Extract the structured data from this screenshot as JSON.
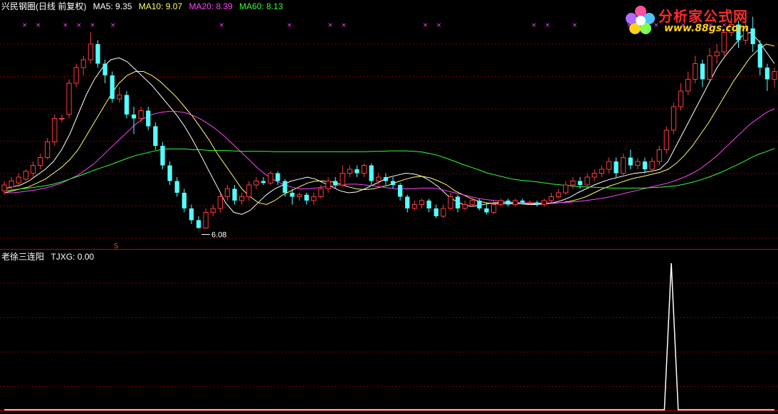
{
  "header_main": {
    "stock": "兴民钢圈(日线 前复权)",
    "ma5_label": "MA5: 9.35",
    "ma10_label": "MA10: 9.07",
    "ma20_label": "MA20: 8.39",
    "ma60_label": "MA60: 8.13"
  },
  "header_sub": {
    "indicator": "老徐三连阳",
    "value": "TJXG: 0.00"
  },
  "low_annotation": "6.08",
  "signal_marker": "S",
  "logo": {
    "text": "分析家公式网",
    "url": "www.88gs.com"
  },
  "colors": {
    "up": "#ff3c3c",
    "down": "#55ffff",
    "ma5": "#ffffff",
    "ma10": "#ffff66",
    "ma20": "#ff44ff",
    "ma60": "#33ff33",
    "grid": "#880000",
    "marker": "#ff44ff"
  },
  "chart_data": [
    {
      "type": "candlestick",
      "title": "兴民钢圈(日线 前复权)",
      "ylim": [
        5.6,
        11.6
      ],
      "grid": true,
      "series": [
        {
          "name": "MA5",
          "values": [
            7.1,
            7.15,
            7.2,
            7.3,
            7.45,
            7.6,
            7.8,
            8.1,
            8.5,
            9.0,
            9.5,
            9.9,
            10.2,
            10.4,
            10.45,
            10.35,
            10.15,
            9.95,
            9.75,
            9.5,
            9.25,
            9.0,
            8.7,
            8.35,
            7.95,
            7.55,
            7.15,
            6.75,
            6.5,
            6.45,
            6.55,
            6.75,
            6.95,
            7.1,
            7.2,
            7.3,
            7.35,
            7.4,
            7.35,
            7.25,
            7.15,
            7.05,
            7.0,
            7.02,
            7.1,
            7.2,
            7.3,
            7.4,
            7.45,
            7.5,
            7.48,
            7.42,
            7.3,
            7.15,
            6.95,
            6.8,
            6.7,
            6.65,
            6.68,
            6.72,
            6.75,
            6.75,
            6.74,
            6.72,
            6.7,
            6.7,
            6.72,
            6.75,
            6.8,
            6.88,
            7.0,
            7.1,
            7.2,
            7.28,
            7.35,
            7.4,
            7.45,
            7.5,
            7.52,
            7.55,
            7.6,
            7.8,
            8.2,
            8.6,
            9.0,
            9.4,
            9.8,
            10.2,
            10.5,
            10.75,
            11.0,
            11.1,
            10.9,
            10.6,
            10.3
          ]
        },
        {
          "name": "MA10",
          "values": [
            7.0,
            7.05,
            7.1,
            7.15,
            7.25,
            7.35,
            7.5,
            7.65,
            7.85,
            8.1,
            8.45,
            8.8,
            9.15,
            9.5,
            9.8,
            10.0,
            10.1,
            10.1,
            10.0,
            9.85,
            9.65,
            9.45,
            9.2,
            8.95,
            8.65,
            8.35,
            8.0,
            7.7,
            7.4,
            7.1,
            6.9,
            6.75,
            6.7,
            6.8,
            6.95,
            7.05,
            7.15,
            7.25,
            7.3,
            7.3,
            7.28,
            7.22,
            7.15,
            7.1,
            7.08,
            7.1,
            7.15,
            7.2,
            7.28,
            7.35,
            7.4,
            7.42,
            7.38,
            7.3,
            7.2,
            7.05,
            6.95,
            6.85,
            6.78,
            6.74,
            6.72,
            6.72,
            6.72,
            6.72,
            6.72,
            6.72,
            6.72,
            6.73,
            6.75,
            6.78,
            6.83,
            6.9,
            7.0,
            7.1,
            7.18,
            7.25,
            7.32,
            7.38,
            7.42,
            7.47,
            7.52,
            7.6,
            7.75,
            7.95,
            8.2,
            8.5,
            8.8,
            9.15,
            9.5,
            9.85,
            10.15,
            10.45,
            10.65,
            10.8,
            10.75
          ]
        },
        {
          "name": "MA20",
          "values": [
            7.0,
            7.0,
            7.02,
            7.05,
            7.08,
            7.12,
            7.18,
            7.25,
            7.35,
            7.45,
            7.6,
            7.75,
            7.95,
            8.15,
            8.35,
            8.55,
            8.75,
            8.9,
            9.0,
            9.05,
            9.08,
            9.08,
            9.05,
            8.98,
            8.88,
            8.75,
            8.6,
            8.42,
            8.22,
            8.02,
            7.82,
            7.62,
            7.45,
            7.32,
            7.22,
            7.15,
            7.1,
            7.1,
            7.12,
            7.15,
            7.18,
            7.2,
            7.22,
            7.22,
            7.2,
            7.18,
            7.15,
            7.12,
            7.1,
            7.1,
            7.1,
            7.12,
            7.12,
            7.1,
            7.05,
            7.0,
            6.95,
            6.9,
            6.85,
            6.82,
            6.8,
            6.78,
            6.76,
            6.75,
            6.74,
            6.74,
            6.74,
            6.74,
            6.75,
            6.76,
            6.78,
            6.8,
            6.83,
            6.86,
            6.9,
            6.95,
            7.0,
            7.05,
            7.1,
            7.15,
            7.2,
            7.25,
            7.32,
            7.4,
            7.5,
            7.62,
            7.78,
            7.95,
            8.15,
            8.35,
            8.55,
            8.75,
            8.9,
            9.05,
            9.15
          ]
        },
        {
          "name": "MA60",
          "values": [
            7.05,
            7.07,
            7.1,
            7.12,
            7.15,
            7.18,
            7.22,
            7.28,
            7.35,
            7.42,
            7.5,
            7.58,
            7.65,
            7.72,
            7.8,
            7.88,
            7.95,
            8.0,
            8.05,
            8.1,
            8.12,
            8.12,
            8.12,
            8.1,
            8.1,
            8.08,
            8.08,
            8.08,
            8.07,
            8.06,
            8.06,
            8.06,
            8.06,
            8.05,
            8.05,
            8.05,
            8.05,
            8.05,
            8.05,
            8.05,
            8.05,
            8.05,
            8.05,
            8.05,
            8.05,
            8.06,
            8.06,
            8.07,
            8.07,
            8.07,
            8.06,
            8.04,
            8.0,
            7.95,
            7.88,
            7.8,
            7.72,
            7.65,
            7.58,
            7.5,
            7.45,
            7.4,
            7.35,
            7.32,
            7.3,
            7.28,
            7.25,
            7.22,
            7.2,
            7.18,
            7.16,
            7.15,
            7.14,
            7.13,
            7.12,
            7.12,
            7.12,
            7.12,
            7.12,
            7.13,
            7.14,
            7.16,
            7.18,
            7.22,
            7.27,
            7.33,
            7.4,
            7.48,
            7.57,
            7.67,
            7.77,
            7.88,
            7.98,
            8.05,
            8.13
          ]
        }
      ],
      "candles": [
        [
          7.05,
          7.2,
          7.3,
          6.95
        ],
        [
          7.15,
          7.3,
          7.4,
          7.05
        ],
        [
          7.25,
          7.4,
          7.5,
          7.15
        ],
        [
          7.35,
          7.55,
          7.6,
          7.3
        ],
        [
          7.5,
          7.7,
          7.8,
          7.4
        ],
        [
          7.7,
          7.9,
          8.0,
          7.6
        ],
        [
          7.9,
          8.3,
          8.4,
          7.85
        ],
        [
          8.3,
          8.9,
          9.0,
          8.2
        ],
        [
          8.9,
          8.9,
          9.0,
          8.8
        ],
        [
          9.0,
          9.8,
          9.9,
          8.9
        ],
        [
          9.8,
          10.2,
          10.3,
          9.7
        ],
        [
          10.2,
          10.4,
          10.5,
          10.0
        ],
        [
          10.4,
          10.8,
          11.1,
          10.3
        ],
        [
          10.8,
          10.3,
          10.9,
          10.2
        ],
        [
          10.3,
          10.0,
          10.4,
          9.8
        ],
        [
          10.0,
          9.4,
          10.1,
          9.3
        ],
        [
          9.4,
          9.5,
          9.7,
          9.3
        ],
        [
          9.5,
          9.0,
          9.6,
          8.9
        ],
        [
          9.0,
          8.9,
          9.2,
          8.5
        ],
        [
          8.9,
          9.1,
          9.2,
          8.8
        ],
        [
          9.1,
          8.7,
          9.2,
          8.6
        ],
        [
          8.7,
          8.2,
          8.8,
          8.1
        ],
        [
          8.2,
          7.7,
          8.3,
          7.6
        ],
        [
          7.7,
          7.3,
          7.8,
          7.2
        ],
        [
          7.3,
          7.0,
          7.4,
          6.9
        ],
        [
          7.0,
          6.6,
          7.1,
          6.5
        ],
        [
          6.6,
          6.3,
          6.7,
          6.2
        ],
        [
          6.3,
          6.1,
          6.4,
          6.08
        ],
        [
          6.1,
          6.5,
          6.6,
          6.08
        ],
        [
          6.5,
          6.6,
          6.7,
          6.4
        ],
        [
          6.6,
          6.9,
          7.0,
          6.5
        ],
        [
          6.9,
          7.1,
          7.2,
          6.8
        ],
        [
          7.1,
          6.8,
          7.2,
          6.7
        ],
        [
          6.8,
          6.9,
          7.0,
          6.7
        ],
        [
          6.9,
          7.2,
          7.3,
          6.8
        ],
        [
          7.2,
          7.3,
          7.4,
          7.1
        ],
        [
          7.3,
          7.25,
          7.4,
          7.2
        ],
        [
          7.25,
          7.5,
          7.55,
          7.2
        ],
        [
          7.5,
          7.3,
          7.55,
          7.2
        ],
        [
          7.3,
          7.0,
          7.35,
          6.9
        ],
        [
          7.0,
          6.9,
          7.1,
          6.7
        ],
        [
          6.9,
          6.95,
          7.0,
          6.8
        ],
        [
          6.95,
          6.8,
          7.0,
          6.7
        ],
        [
          6.8,
          6.9,
          7.0,
          6.7
        ],
        [
          6.9,
          7.1,
          7.2,
          6.85
        ],
        [
          7.1,
          7.3,
          7.4,
          7.0
        ],
        [
          7.3,
          7.2,
          7.4,
          7.1
        ],
        [
          7.2,
          7.5,
          7.7,
          7.15
        ],
        [
          7.5,
          7.6,
          7.7,
          7.4
        ],
        [
          7.6,
          7.5,
          7.7,
          7.4
        ],
        [
          7.5,
          7.7,
          7.75,
          7.4
        ],
        [
          7.7,
          7.3,
          7.75,
          7.2
        ],
        [
          7.3,
          7.4,
          7.5,
          7.2
        ],
        [
          7.4,
          7.3,
          7.5,
          7.2
        ],
        [
          7.3,
          7.2,
          7.4,
          7.1
        ],
        [
          7.2,
          6.9,
          7.25,
          6.8
        ],
        [
          6.9,
          6.6,
          6.95,
          6.5
        ],
        [
          6.6,
          6.7,
          6.8,
          6.55
        ],
        [
          6.7,
          6.8,
          6.85,
          6.6
        ],
        [
          6.8,
          6.6,
          6.85,
          6.5
        ],
        [
          6.6,
          6.4,
          6.7,
          6.35
        ],
        [
          6.4,
          6.6,
          6.7,
          6.35
        ],
        [
          6.6,
          6.9,
          7.0,
          6.55
        ],
        [
          6.9,
          6.6,
          6.95,
          6.5
        ],
        [
          6.6,
          6.7,
          6.8,
          6.55
        ],
        [
          6.7,
          6.8,
          6.9,
          6.65
        ],
        [
          6.8,
          6.6,
          6.85,
          6.55
        ],
        [
          6.6,
          6.5,
          6.7,
          6.45
        ],
        [
          6.5,
          6.7,
          6.8,
          6.45
        ],
        [
          6.7,
          6.8,
          6.85,
          6.65
        ],
        [
          6.8,
          6.7,
          6.85,
          6.65
        ],
        [
          6.7,
          6.8,
          6.85,
          6.65
        ],
        [
          6.8,
          6.75,
          6.85,
          6.7
        ],
        [
          6.75,
          6.75,
          6.8,
          6.7
        ],
        [
          6.75,
          6.7,
          6.8,
          6.65
        ],
        [
          6.7,
          6.8,
          6.85,
          6.65
        ],
        [
          6.8,
          6.9,
          7.0,
          6.75
        ],
        [
          6.9,
          7.0,
          7.1,
          6.85
        ],
        [
          7.0,
          7.2,
          7.3,
          6.95
        ],
        [
          7.2,
          7.3,
          7.4,
          7.1
        ],
        [
          7.3,
          7.2,
          7.4,
          7.1
        ],
        [
          7.2,
          7.4,
          7.5,
          7.15
        ],
        [
          7.4,
          7.5,
          7.6,
          7.3
        ],
        [
          7.5,
          7.6,
          7.7,
          7.4
        ],
        [
          7.6,
          7.8,
          7.9,
          7.5
        ],
        [
          7.8,
          7.5,
          7.9,
          7.4
        ],
        [
          7.5,
          7.9,
          8.0,
          7.45
        ],
        [
          7.9,
          7.7,
          8.1,
          7.6
        ],
        [
          7.7,
          7.8,
          7.9,
          7.6
        ],
        [
          7.8,
          7.6,
          7.9,
          7.5
        ],
        [
          7.6,
          7.8,
          7.9,
          7.55
        ],
        [
          7.8,
          8.1,
          8.2,
          7.7
        ],
        [
          8.1,
          8.6,
          8.7,
          8.0
        ],
        [
          8.6,
          9.2,
          9.3,
          8.5
        ],
        [
          9.2,
          9.6,
          9.8,
          9.1
        ],
        [
          9.6,
          9.9,
          10.1,
          9.5
        ],
        [
          9.9,
          10.3,
          10.5,
          9.8
        ],
        [
          10.3,
          9.9,
          10.4,
          9.7
        ],
        [
          9.9,
          10.5,
          10.7,
          9.85
        ],
        [
          10.5,
          10.6,
          10.8,
          10.3
        ],
        [
          10.6,
          11.1,
          11.2,
          10.5
        ],
        [
          11.1,
          11.3,
          11.6,
          11.0
        ],
        [
          11.3,
          10.9,
          11.4,
          10.7
        ],
        [
          10.9,
          11.2,
          11.4,
          10.8
        ],
        [
          11.2,
          10.8,
          11.5,
          10.6
        ],
        [
          10.8,
          10.2,
          10.9,
          10.0
        ],
        [
          10.2,
          9.9,
          10.3,
          9.6
        ],
        [
          9.9,
          10.1,
          10.2,
          9.7
        ]
      ],
      "low_label": "6.08"
    },
    {
      "type": "line",
      "title": "老徐三连阳",
      "series": [
        {
          "name": "TJXG",
          "values": [
            0,
            0,
            0,
            0,
            0,
            0,
            0,
            0,
            0,
            0,
            0,
            0,
            0,
            0,
            0,
            0,
            0,
            0,
            0,
            0,
            0,
            0,
            0,
            0,
            0,
            0,
            0,
            0,
            0,
            0,
            0,
            0,
            0,
            0,
            0,
            0,
            0,
            0,
            0,
            0,
            0,
            0,
            0,
            0,
            0,
            0,
            0,
            0,
            0,
            0,
            0,
            0,
            0,
            0,
            0,
            0,
            0,
            0,
            0,
            0,
            0,
            0,
            0,
            0,
            0,
            0,
            0,
            0,
            0,
            0,
            0,
            0,
            0,
            0,
            0,
            0,
            0,
            0,
            0,
            0,
            0,
            0,
            0,
            0,
            0,
            0,
            0,
            0,
            0,
            0,
            0,
            0,
            0,
            0,
            0,
            0,
            0,
            1,
            0,
            0,
            0,
            0,
            0,
            0,
            0,
            0,
            0,
            0,
            0,
            0,
            0,
            0,
            0
          ]
        }
      ],
      "ylim": [
        0,
        1
      ]
    }
  ]
}
